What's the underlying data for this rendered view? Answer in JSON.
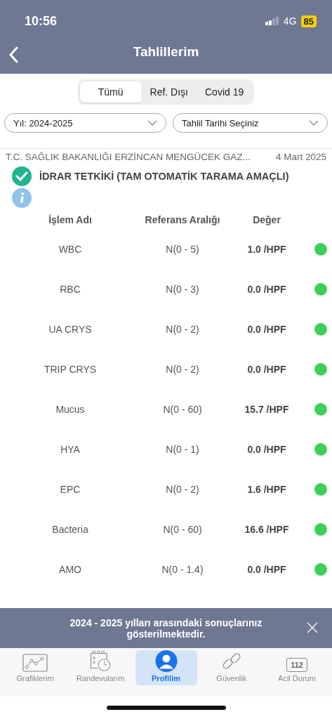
{
  "status_bar": {
    "time": "10:56",
    "network": "4G",
    "battery": "85"
  },
  "header": {
    "title": "Tahlillerim"
  },
  "segments": [
    {
      "label": "Tümü",
      "selected": true
    },
    {
      "label": "Ref. Dışı",
      "selected": false
    },
    {
      "label": "Covid 19",
      "selected": false
    }
  ],
  "filters": [
    {
      "value": "Yıl: 2024-2025"
    },
    {
      "value": "Tahlil Tarihi Seçiniz"
    }
  ],
  "hospital": "T.C. SAĞLIK BAKANLIĞI ERZİNCAN MENGÜCEK GAZ...",
  "date": "4 Mart 2025",
  "test": {
    "title": "İDRAR TETKİKİ (TAM OTOMATİK TARAMA AMAÇLI)",
    "checked": true
  },
  "table": {
    "columns": [
      "İşlem Adı",
      "Referans Aralığı",
      "Değer"
    ],
    "rows": [
      {
        "name": "WBC",
        "range": "N(0 - 5)",
        "value": "1.0 /HPF"
      },
      {
        "name": "RBC",
        "range": "N(0 - 3)",
        "value": "0.0 /HPF"
      },
      {
        "name": "UA CRYS",
        "range": "N(0 - 2)",
        "value": "0.0 /HPF"
      },
      {
        "name": "TRIP CRYS",
        "range": "N(0 - 2)",
        "value": "0.0 /HPF"
      },
      {
        "name": "Mucus",
        "range": "N(0 - 60)",
        "value": "15.7 /HPF"
      },
      {
        "name": "HYA",
        "range": "N(0 - 1)",
        "value": "0.0 /HPF"
      },
      {
        "name": "EPC",
        "range": "N(0 - 2)",
        "value": "1.6 /HPF"
      },
      {
        "name": "Bacteria",
        "range": "N(0 - 60)",
        "value": "16.6 /HPF"
      },
      {
        "name": "AMO",
        "range": "N(0 - 1.4)",
        "value": "0.0 /HPF"
      }
    ]
  },
  "toast": {
    "message": "2024 - 2025 yılları arasındaki sonuçlarınız gösterilmektedir."
  },
  "tab_bar": [
    {
      "label": "Grafiklerim",
      "kind": "chart",
      "selected": false
    },
    {
      "label": "Randevularım",
      "kind": "calendar",
      "selected": false
    },
    {
      "label": "Profilim",
      "kind": "profile",
      "selected": true
    },
    {
      "label": "Güvenlik",
      "kind": "link",
      "selected": false
    },
    {
      "label": "Acil Durum",
      "kind": "emergency",
      "icon_text": "112",
      "selected": false
    }
  ]
}
